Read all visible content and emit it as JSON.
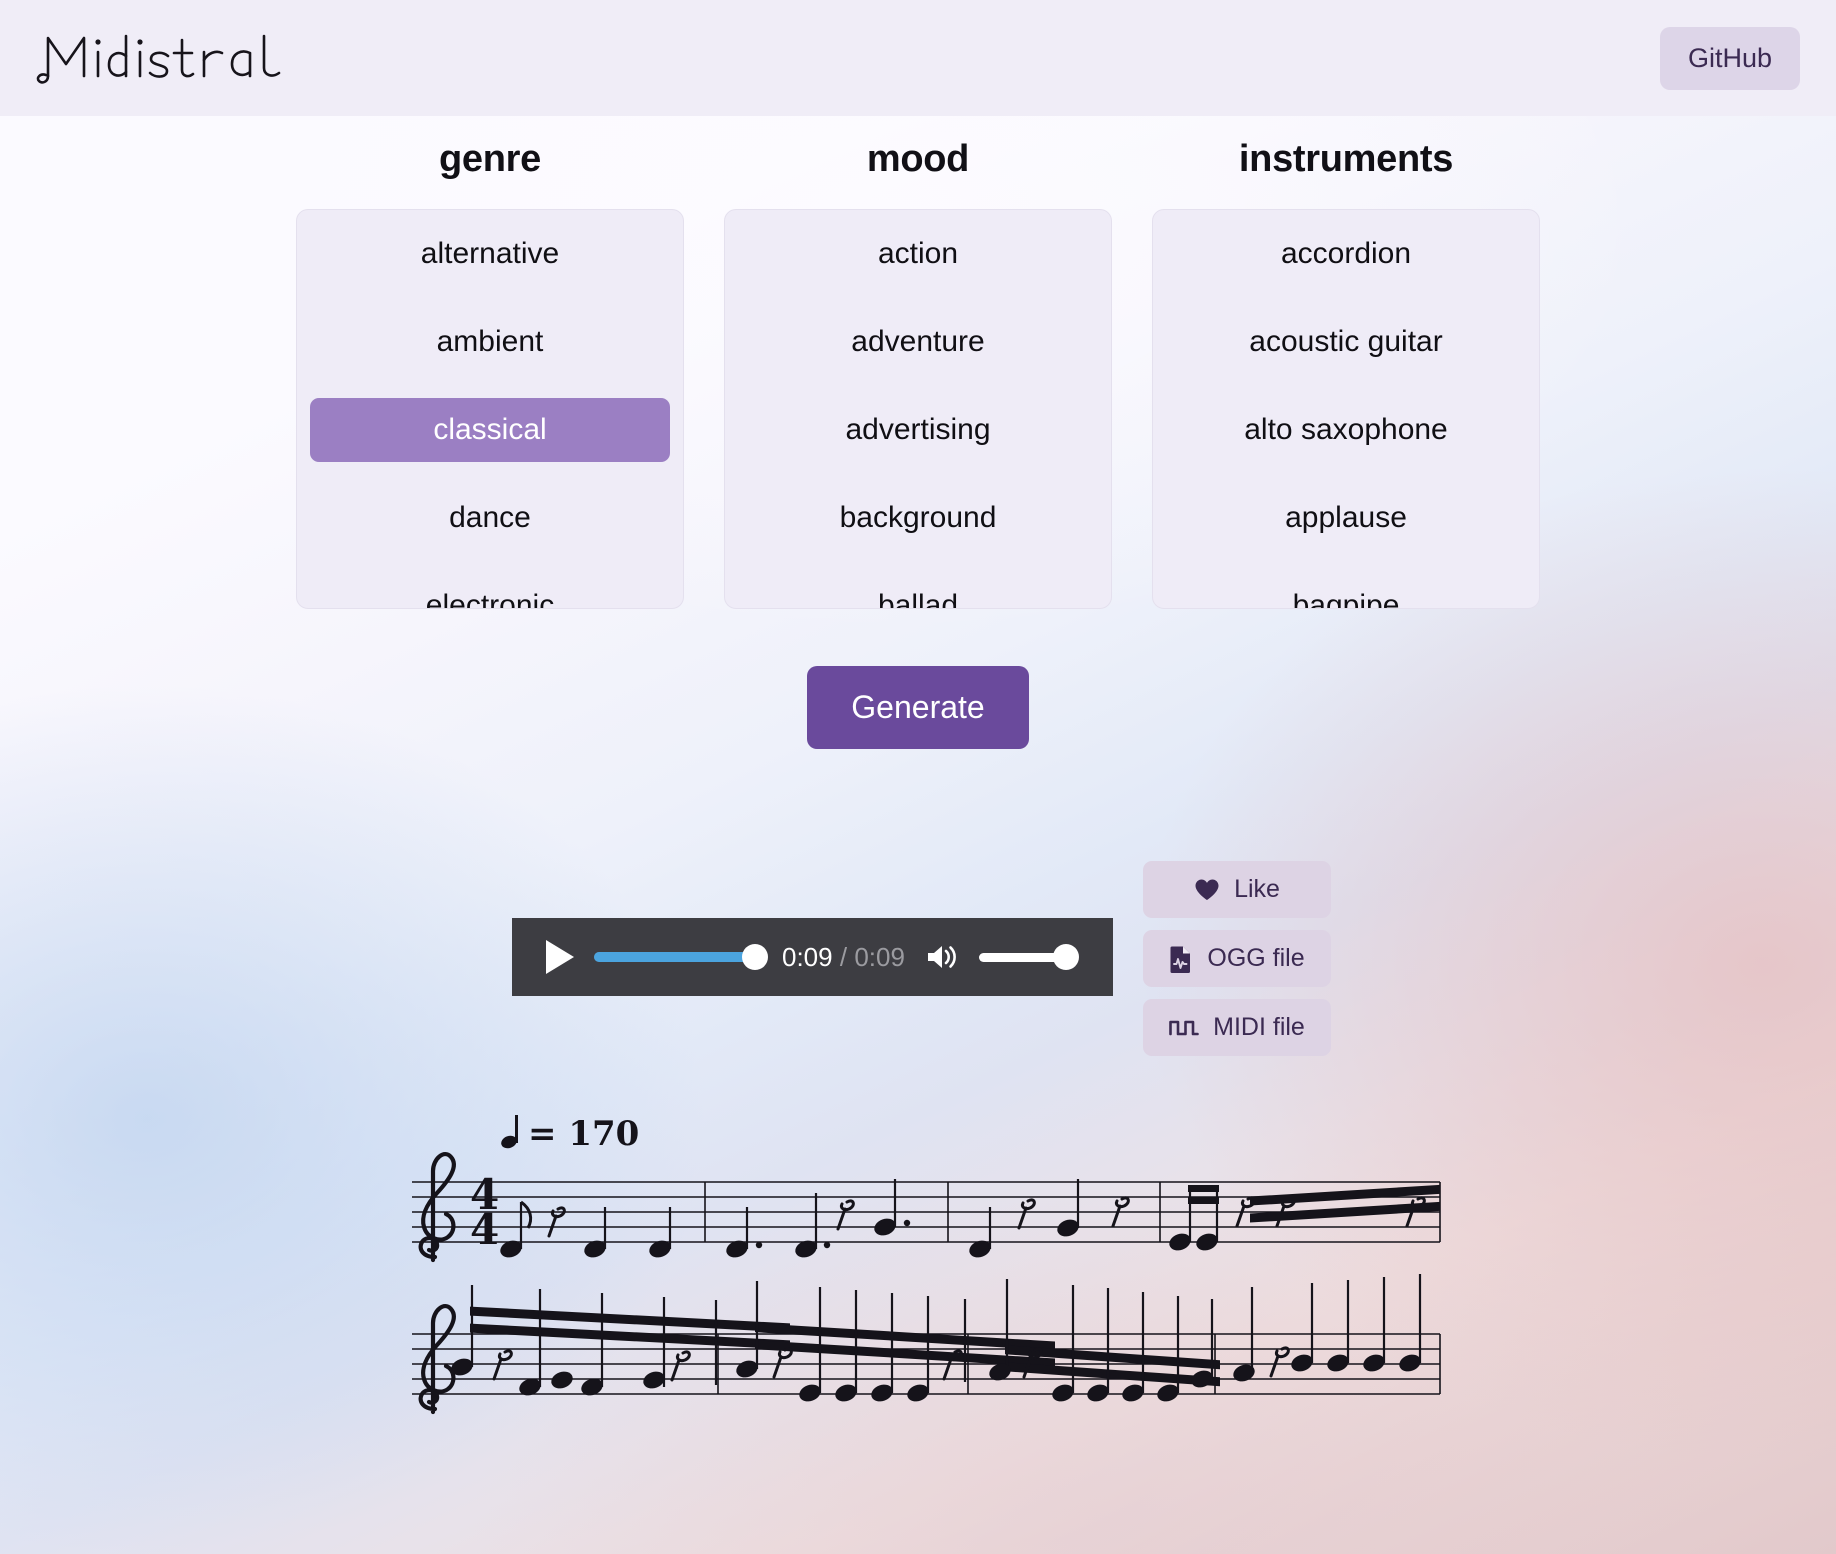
{
  "header": {
    "logo_text": "Midistral",
    "github_label": "GitHub"
  },
  "selectors": [
    {
      "title": "genre",
      "name": "genre",
      "options": [
        "alternative",
        "ambient",
        "classical",
        "dance",
        "electronic"
      ],
      "selected": "classical"
    },
    {
      "title": "mood",
      "name": "mood",
      "options": [
        "action",
        "adventure",
        "advertising",
        "background",
        "ballad"
      ],
      "selected": ""
    },
    {
      "title": "instruments",
      "name": "instruments",
      "options": [
        "accordion",
        "acoustic guitar",
        "alto saxophone",
        "applause",
        "bagpipe"
      ],
      "selected": ""
    }
  ],
  "generate": {
    "label": "Generate"
  },
  "player": {
    "play_icon": "play-icon",
    "current_time": "0:09",
    "separator": "/",
    "total_time": "0:09",
    "progress_percent": 100,
    "volume_percent": 100,
    "speaker_icon": "speaker-icon",
    "progress_color": "#4ba4df",
    "background_color": "#3d3d42"
  },
  "actions": [
    {
      "label": "Like",
      "icon": "heart-icon",
      "name": "like-button"
    },
    {
      "label": "OGG file",
      "icon": "audio-file-icon",
      "name": "ogg-file-button"
    },
    {
      "label": "MIDI file",
      "icon": "square-wave-icon",
      "name": "midi-file-button"
    }
  ],
  "score": {
    "tempo_note": "quarter-note",
    "tempo_equals": "=",
    "tempo_bpm": "170",
    "clef": "treble-clef",
    "time_signature_numerator": "4",
    "time_signature_denominator": "4",
    "staff_line_count": 5,
    "system_count": 2
  },
  "colors": {
    "header_bg": "#f0edf7",
    "accent_purple": "#6a4a9c",
    "selected_purple": "#9b7fc3",
    "chip_lavender": "#ddd3e4",
    "listbox_bg": "#efecf7",
    "text_dark": "#3b2a52"
  }
}
